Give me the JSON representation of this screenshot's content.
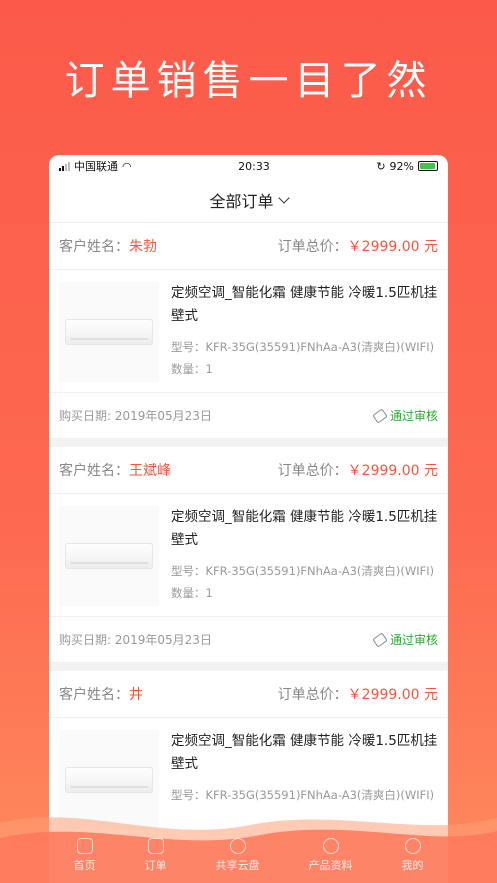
{
  "headline": "订单销售一目了然",
  "status": {
    "carrier": "中国联通",
    "time": "20:33",
    "battery": "92%"
  },
  "nav": {
    "title": "全部订单"
  },
  "labels": {
    "customer": "客户姓名：",
    "total": "订单总价：",
    "model_prefix": "型号：",
    "qty_prefix": "数量：",
    "date_prefix": "购买日期: "
  },
  "orders": [
    {
      "customer": "朱勃",
      "price": "￥2999.00 元",
      "title": "定频空调_智能化霜 健康节能 冷暖1.5匹机挂壁式",
      "model": "KFR-35G(35591)FNhAa-A3(清爽白)(WIFI)",
      "qty": "1",
      "date": "2019年05月23日",
      "status": "通过审核"
    },
    {
      "customer": "王斌峰",
      "price": "￥2999.00 元",
      "title": "定频空调_智能化霜 健康节能 冷暖1.5匹机挂壁式",
      "model": "KFR-35G(35591)FNhAa-A3(清爽白)(WIFI)",
      "qty": "1",
      "date": "2019年05月23日",
      "status": "通过审核"
    },
    {
      "customer": "井",
      "price": "￥2999.00 元",
      "title": "定频空调_智能化霜 健康节能 冷暖1.5匹机挂壁式",
      "model": "KFR-35G(35591)FNhAa-A3(清爽白)(WIFI)"
    }
  ],
  "tabs": [
    {
      "label": "首页",
      "icon": "store-icon"
    },
    {
      "label": "订单",
      "icon": "order-icon"
    },
    {
      "label": "共享云盘",
      "icon": "cloud-disk-icon"
    },
    {
      "label": "产品资料",
      "icon": "compass-icon"
    },
    {
      "label": "我的",
      "icon": "user-icon"
    }
  ]
}
